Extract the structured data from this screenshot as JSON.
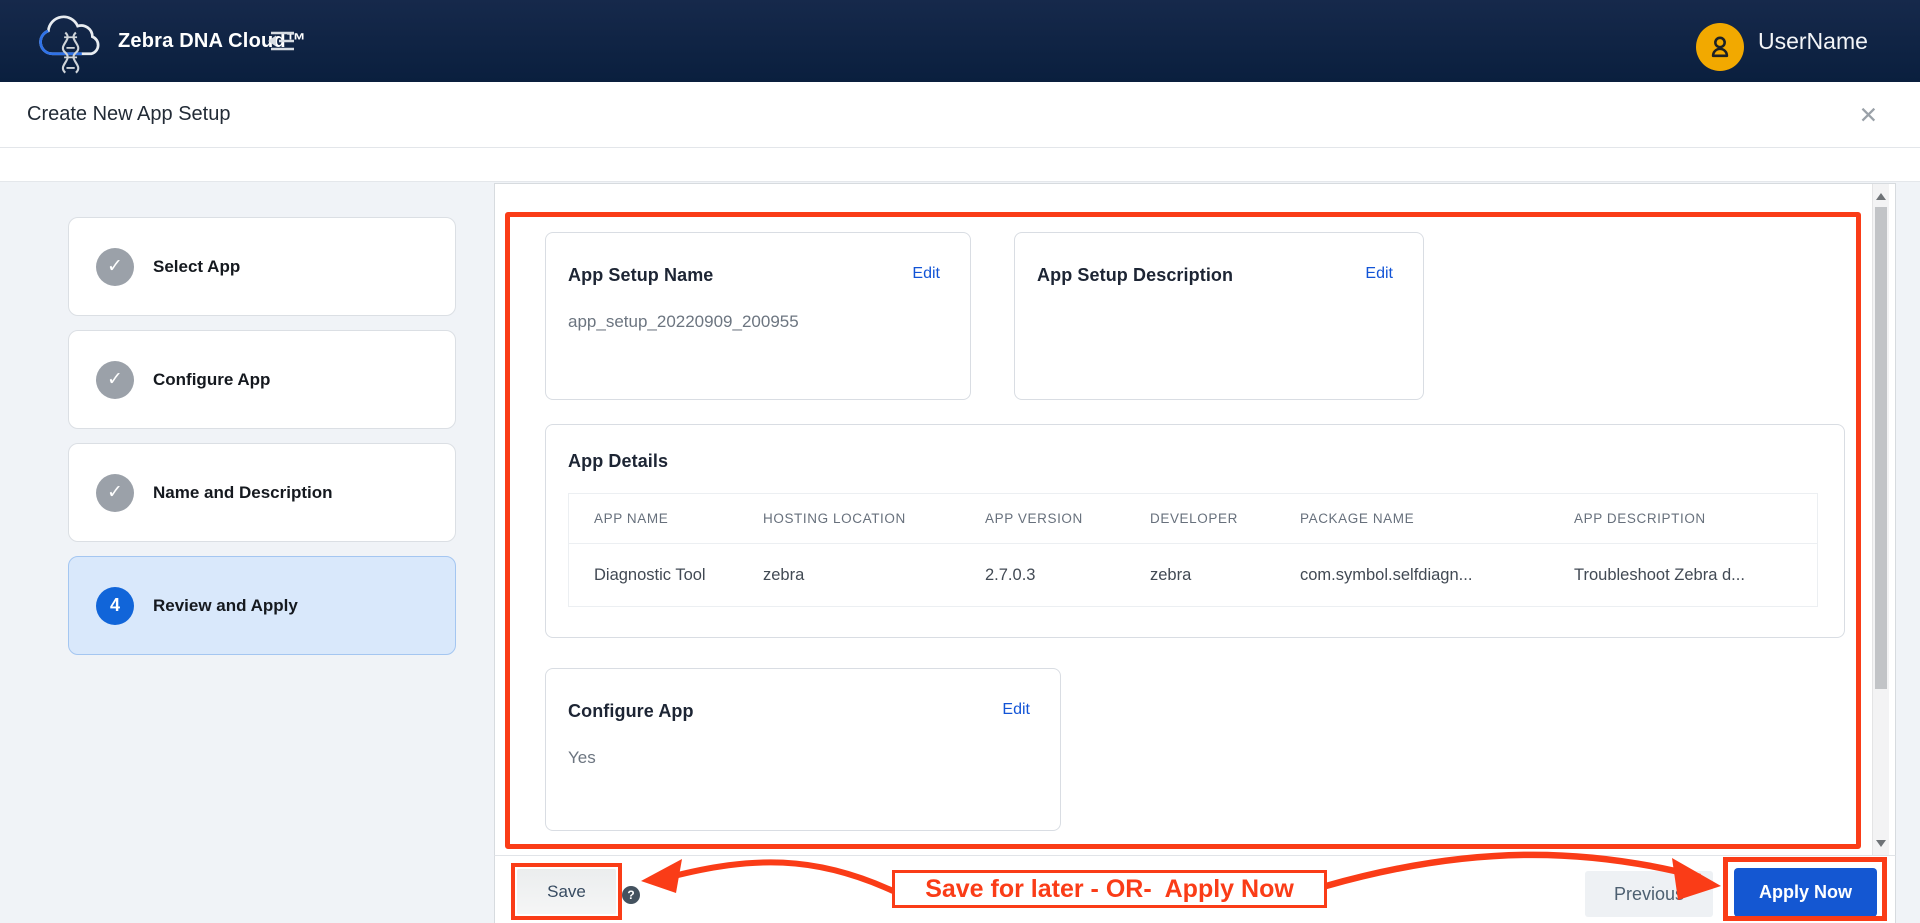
{
  "topbar": {
    "brand": "Zebra DNA Cloud™",
    "username": "UserName"
  },
  "header": {
    "title": "Create New App Setup",
    "close_glyph": "✕"
  },
  "stepper": {
    "check_glyph": "✓",
    "steps": [
      {
        "label": "Select App",
        "state": "done"
      },
      {
        "label": "Configure App",
        "state": "done"
      },
      {
        "label": "Name and Description",
        "state": "done"
      },
      {
        "label": "Review and Apply",
        "state": "active",
        "number": "4"
      }
    ]
  },
  "review": {
    "name_card": {
      "title": "App Setup Name",
      "action": "Edit",
      "value": "app_setup_20220909_200955"
    },
    "description_card": {
      "title": "App Setup Description",
      "action": "Edit",
      "value": ""
    },
    "details_card": {
      "title": "App Details",
      "columns": [
        "APP NAME",
        "HOSTING LOCATION",
        "APP VERSION",
        "DEVELOPER",
        "PACKAGE NAME",
        "APP DESCRIPTION"
      ],
      "rows": [
        [
          "Diagnostic Tool",
          "zebra",
          "2.7.0.3",
          "zebra",
          "com.symbol.selfdiagn...",
          "Troubleshoot Zebra d..."
        ]
      ]
    },
    "configure_card": {
      "title": "Configure App",
      "action": "Edit",
      "value": "Yes"
    }
  },
  "footer": {
    "save_label": "Save",
    "help_glyph": "?",
    "previous_label": "Previous",
    "apply_label": "Apply Now"
  },
  "annotation": {
    "label": "Save for later - OR-  Apply Now",
    "color": "#fa3c17"
  },
  "colors": {
    "topbar_navy": "#0d2342",
    "accent_blue": "#1457d2",
    "link_blue": "#1254d6",
    "active_step_bg": "#d9e8fb",
    "avatar_amber": "#f2a900",
    "annotation_red": "#fa3c17",
    "page_gray": "#f0f3f7"
  }
}
